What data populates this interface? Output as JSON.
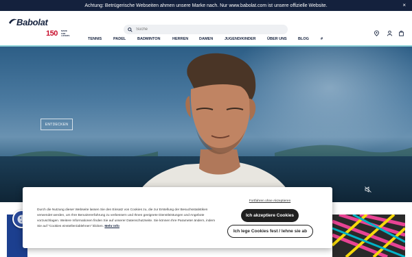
{
  "announcement": {
    "text": "Achtung: Betrügerische Webseiten ahmen unsere Marke nach. Nur www.babolat.com ist unsere offizielle Website.",
    "close_glyph": "×"
  },
  "logo": {
    "wordmark": "Babolat",
    "anniversary": "150",
    "claim_lines": [
      "MADE",
      "FOR",
      "LOVERS"
    ]
  },
  "search": {
    "placeholder": "Suche",
    "icon": "search-icon"
  },
  "utility_icons": [
    "location-pin-icon",
    "user-icon",
    "shopping-bag-icon"
  ],
  "nav": {
    "items": [
      "TENNIS",
      "PADEL",
      "BADMINTON",
      "HERREN",
      "DAMEN",
      "JUGEND/KINDER",
      "ÜBER UNS",
      "BLOG",
      "#"
    ]
  },
  "hero": {
    "cta_label": "ENTDECKEN",
    "mute_icon": "mute-icon"
  },
  "cookie_banner": {
    "text": "Durch die Nutzung dieser Webseite lassen Sie den Einsatz von Cookies zu, die zur Erstellung der Besuchsstatistiken verwendet werden, um Ihre Benutzererfahrung zu verbessern und Ihnen geeignete Dienstleistungen und Angebote vorzuschlagen. Weitere Informationen finden Sie auf unserer Datenschutzseite. Sie können Ihre Parameter ändern, indem Sie auf \"Cookies einstellen/ablehnen\" klicken.",
    "more_link": "Mehr Info",
    "continue_without": "Fortfahren ohne Akzeptieren",
    "accept_label": "Ich akzeptiere Cookies",
    "settings_label": "Ich lege Cookies fest / lehne sie ab"
  },
  "colors": {
    "navy": "#14213d",
    "accent_line": "#8fd3d8",
    "button_dark": "#1f1f1f"
  }
}
